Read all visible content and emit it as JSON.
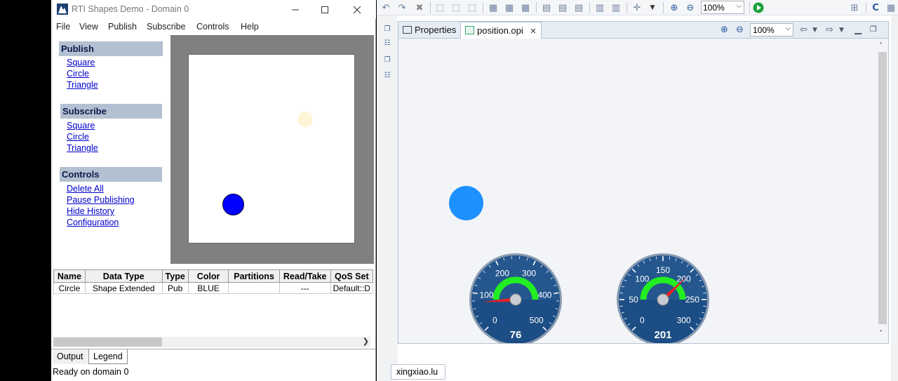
{
  "shapes_window": {
    "title": "RTI Shapes Demo - Domain 0",
    "menu": [
      "File",
      "View",
      "Publish",
      "Subscribe",
      "Controls",
      "Help"
    ],
    "sections": [
      {
        "title": "Publish",
        "links": [
          "Square",
          "Circle",
          "Triangle"
        ]
      },
      {
        "title": "Subscribe",
        "links": [
          "Square",
          "Circle",
          "Triangle"
        ]
      },
      {
        "title": "Controls",
        "links": [
          "Delete All",
          "Pause Publishing",
          "Hide History",
          "Configuration"
        ]
      }
    ],
    "canvas_shapes": [
      {
        "kind": "circle",
        "color": "#0000ff"
      },
      {
        "kind": "circle",
        "color": "#fff5d6"
      }
    ],
    "table": {
      "columns": [
        "Name",
        "Data Type",
        "Type",
        "Color",
        "Partitions",
        "Read/Take",
        "QoS Set"
      ],
      "rows": [
        [
          "Circle",
          "Shape Extended",
          "Pub",
          "BLUE",
          "",
          "---",
          "Default::D"
        ]
      ]
    },
    "bottom_tabs": [
      "Output",
      "Legend"
    ],
    "status": "Ready on domain 0"
  },
  "ide": {
    "toolbar_zoom": "100%",
    "tabs": [
      {
        "label": "Properties",
        "icon": "properties-icon"
      },
      {
        "label": "position.opi",
        "icon": "opi-file-icon",
        "close": "✕"
      }
    ],
    "editor_zoom": "100%",
    "status_tab": "xingxiao.lu",
    "colors": {
      "circle": "#1e90ff",
      "gauge_face": "#1c4d84",
      "gauge_arc": "#22ee22",
      "needle": "#ee2222"
    }
  },
  "gauges": [
    {
      "value": 76,
      "value_label": "76",
      "min": 0,
      "max": 500,
      "ticks": [
        "0",
        "100",
        "200",
        "300",
        "400",
        "500"
      ]
    },
    {
      "value": 201,
      "value_label": "201",
      "min": 0,
      "max": 300,
      "ticks": [
        "0",
        "50",
        "100",
        "150",
        "200",
        "250",
        "300"
      ]
    }
  ]
}
